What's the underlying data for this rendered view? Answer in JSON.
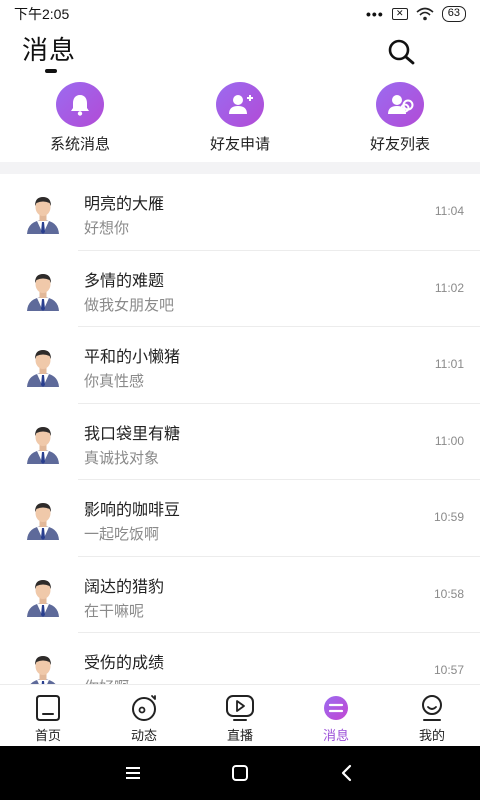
{
  "status_bar": {
    "time": "下午2:05",
    "signal_dots": "•••",
    "battery": "63"
  },
  "header": {
    "title": "消息"
  },
  "quick_actions": [
    {
      "label": "系统消息",
      "icon": "bell-icon"
    },
    {
      "label": "好友申请",
      "icon": "add-user-icon"
    },
    {
      "label": "好友列表",
      "icon": "friends-list-icon"
    }
  ],
  "conversations": [
    {
      "name": "明亮的大雁",
      "preview": "好想你",
      "time": "11:04"
    },
    {
      "name": "多情的难题",
      "preview": "做我女朋友吧",
      "time": "11:02"
    },
    {
      "name": "平和的小懒猪",
      "preview": "你真性感",
      "time": "11:01"
    },
    {
      "name": "我口袋里有糖",
      "preview": "真诚找对象",
      "time": "11:00"
    },
    {
      "name": "影响的咖啡豆",
      "preview": "一起吃饭啊",
      "time": "10:59"
    },
    {
      "name": "阔达的猎豹",
      "preview": "在干嘛呢",
      "time": "10:58"
    },
    {
      "name": "受伤的成绩",
      "preview": "你好啊",
      "time": "10:57"
    }
  ],
  "tabs": [
    {
      "label": "首页",
      "icon": "home-icon"
    },
    {
      "label": "动态",
      "icon": "moments-icon"
    },
    {
      "label": "直播",
      "icon": "live-icon"
    },
    {
      "label": "消息",
      "icon": "message-icon",
      "active": true
    },
    {
      "label": "我的",
      "icon": "profile-icon"
    }
  ],
  "colors": {
    "accent": "#9b4fd8",
    "accent_gradient_start": "#9b6bf0",
    "accent_gradient_end": "#b24bd6"
  }
}
